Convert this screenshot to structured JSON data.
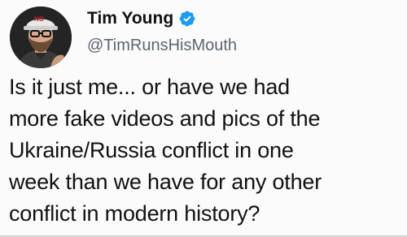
{
  "author": {
    "display_name": "Tim Young",
    "handle": "@TimRunsHisMouth",
    "verified_icon": "verified-badge-icon",
    "avatar_hat_text": "NO"
  },
  "tweet": {
    "lines": [
      "Is it just me... or have we had",
      "more fake videos and pics of the",
      "Ukraine/Russia conflict in one",
      "week than we have for any other",
      "conflict in modern history?"
    ]
  },
  "colors": {
    "verified_blue": "#1d9bf0",
    "text": "#111111",
    "handle_gray": "#5b6670"
  }
}
